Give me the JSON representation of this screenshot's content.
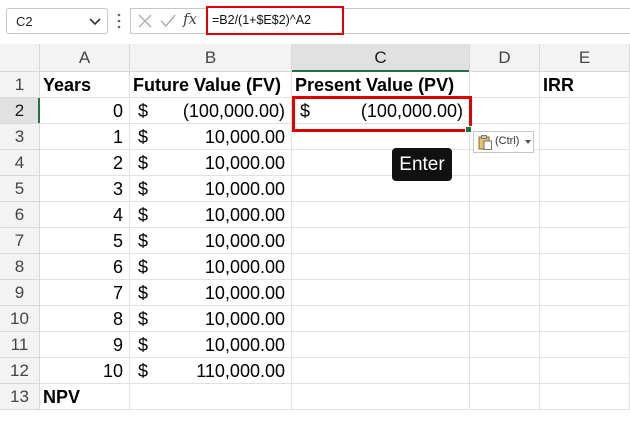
{
  "name_box": {
    "value": "C2"
  },
  "formula_bar": {
    "formula": "=B2/(1+$E$2)^A2",
    "cancel_icon": "x-icon",
    "enter_icon": "check-icon",
    "function_label": "fx"
  },
  "columns": [
    "A",
    "B",
    "C",
    "D",
    "E"
  ],
  "rows": [
    "1",
    "2",
    "3",
    "4",
    "5",
    "6",
    "7",
    "8",
    "9",
    "10",
    "11",
    "12",
    "13"
  ],
  "headers": {
    "years": "Years",
    "future_value": "Future Value (FV)",
    "present_value": "Present Value (PV)",
    "irr": "IRR",
    "npv": "NPV"
  },
  "currency_symbol": "$",
  "data_rows": [
    {
      "year": "0",
      "fv": "(100,000.00)"
    },
    {
      "year": "1",
      "fv": "10,000.00"
    },
    {
      "year": "2",
      "fv": "10,000.00"
    },
    {
      "year": "3",
      "fv": "10,000.00"
    },
    {
      "year": "4",
      "fv": "10,000.00"
    },
    {
      "year": "5",
      "fv": "10,000.00"
    },
    {
      "year": "6",
      "fv": "10,000.00"
    },
    {
      "year": "7",
      "fv": "10,000.00"
    },
    {
      "year": "8",
      "fv": "10,000.00"
    },
    {
      "year": "9",
      "fv": "10,000.00"
    },
    {
      "year": "10",
      "fv": "110,000.00"
    }
  ],
  "c2_value": "(100,000.00)",
  "paste_options": {
    "label": "(Ctrl)"
  },
  "enter_badge": "Enter",
  "colors": {
    "selection": "#217346",
    "highlight": "#e00000"
  }
}
